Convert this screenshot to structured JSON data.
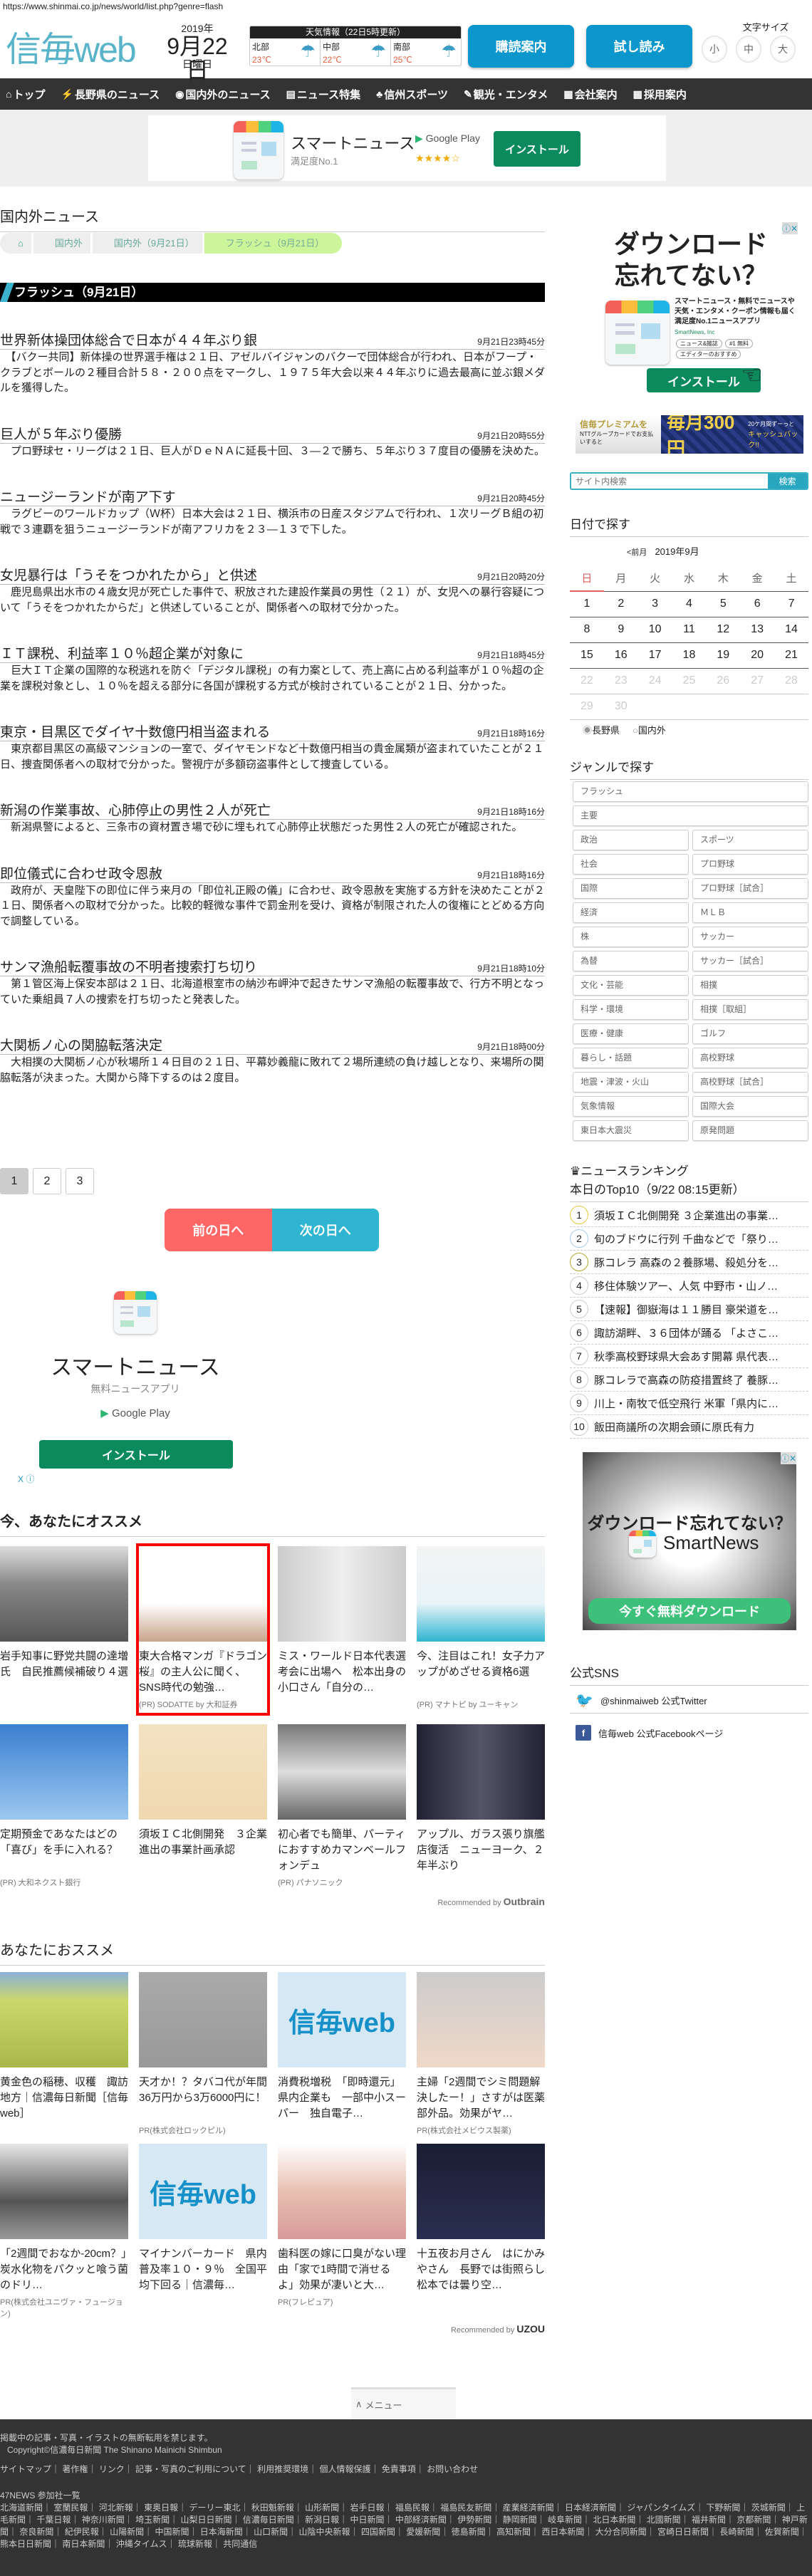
{
  "url": "https://www.shinmai.co.jp/news/world/list.php?genre=flash",
  "header": {
    "logo": "信毎web",
    "year": "2019年",
    "date": "9月22日",
    "weekday": "日曜日",
    "weather": {
      "title": "天気情報（22日5時更新）",
      "regions": [
        {
          "name": "北部",
          "temp": "23℃"
        },
        {
          "name": "中部",
          "temp": "22℃"
        },
        {
          "name": "南部",
          "temp": "25℃"
        }
      ]
    },
    "subscribe": "購読案内",
    "trial": "試し読み",
    "font_size_label": "文字サイズ",
    "font_sizes": [
      "小",
      "中",
      "大"
    ]
  },
  "nav": [
    {
      "icon": "⌂",
      "label": "トップ"
    },
    {
      "icon": "⚡",
      "label": "長野県のニュース"
    },
    {
      "icon": "◉",
      "label": "国内外のニュース"
    },
    {
      "icon": "▤",
      "label": "ニュース特集"
    },
    {
      "icon": "♣",
      "label": "信州スポーツ"
    },
    {
      "icon": "✎",
      "label": "観光・エンタメ"
    },
    {
      "icon": "▦",
      "label": "会社案内"
    },
    {
      "icon": "▦",
      "label": "採用案内"
    }
  ],
  "top_ad": {
    "app": "スマートニュース",
    "sub": "満足度No.1",
    "store": "Google Play",
    "stars": "★★★★☆",
    "install": "インストール"
  },
  "page_title": "国内外ニュース",
  "breadcrumb": [
    "国内外",
    "国内外（9月21日）",
    "フラッシュ（9月21日）"
  ],
  "section_title": "フラッシュ（9月21日）",
  "articles": [
    {
      "title": "世界新体操団体総合で日本が４４年ぶり銀",
      "time": "9月21日23時45分",
      "body": "　【バクー共同】新体操の世界選手権は２１日、アゼルバイジャンのバクーで団体総合が行われ、日本がフープ・クラブとボールの２種目合計５８・２００点をマークし、１９７５年大会以来４４年ぶりに過去最高に並ぶ銀メダルを獲得した。"
    },
    {
      "title": "巨人が５年ぶり優勝",
      "time": "9月21日20時55分",
      "body": "　プロ野球セ・リーグは２１日、巨人がＤｅＮＡに延長十回、３―２で勝ち、５年ぶり３７度目の優勝を決めた。"
    },
    {
      "title": "ニュージーランドが南ア下す",
      "time": "9月21日20時45分",
      "body": "　ラグビーのワールドカップ（Ｗ杯）日本大会は２１日、横浜市の日産スタジアムで行われ、１次リーグＢ組の初戦で３連覇を狙うニュージーランドが南アフリカを２３―１３で下した。"
    },
    {
      "title": "女児暴行は「うそをつかれたから」と供述",
      "time": "9月21日20時20分",
      "body": "　鹿児島県出水市の４歳女児が死亡した事件で、釈放された建設作業員の男性（２１）が、女児への暴行容疑について「うそをつかれたからだ」と供述していることが、関係者への取材で分かった。"
    },
    {
      "title": "ＩＴ課税、利益率１０％超企業が対象に",
      "time": "9月21日18時45分",
      "body": "　巨大ＩＴ企業の国際的な税逃れを防ぐ「デジタル課税」の有力案として、売上高に占める利益率が１０％超の企業を課税対象とし、１０％を超える部分に各国が課税する方式が検討されていることが２１日、分かった。"
    },
    {
      "title": "東京・目黒区でダイヤ十数億円相当盗まれる",
      "time": "9月21日18時16分",
      "body": "　東京都目黒区の高級マンションの一室で、ダイヤモンドなど十数億円相当の貴金属類が盗まれていたことが２１日、捜査関係者への取材で分かった。警視庁が多額窃盗事件として捜査している。"
    },
    {
      "title": "新潟の作業事故、心肺停止の男性２人が死亡",
      "time": "9月21日18時16分",
      "body": "　新潟県警によると、三条市の資材置き場で砂に埋もれて心肺停止状態だった男性２人の死亡が確認された。"
    },
    {
      "title": "即位儀式に合わせ政令恩赦",
      "time": "9月21日18時16分",
      "body": "　政府が、天皇陛下の即位に伴う来月の「即位礼正殿の儀」に合わせ、政令恩赦を実施する方針を決めたことが２１日、関係者への取材で分かった。比較的軽微な事件で罰金刑を受け、資格が制限された人の復権にとどめる方向で調整している。"
    },
    {
      "title": "サンマ漁船転覆事故の不明者捜索打ち切り",
      "time": "9月21日18時10分",
      "body": "　第１管区海上保安本部は２１日、北海道根室市の納沙布岬沖で起きたサンマ漁船の転覆事故で、行方不明となっていた乗組員７人の捜索を打ち切ったと発表した。"
    },
    {
      "title": "大関栃ノ心の関脇転落決定",
      "time": "9月21日18時00分",
      "body": "　大相撲の大関栃ノ心が秋場所１４日目の２１日、平幕妙義龍に敗れて２場所連続の負け越しとなり、来場所の関脇転落が決まった。大関から降下するのは２度目。"
    }
  ],
  "pages": [
    "1",
    "2",
    "3"
  ],
  "prev_day": "前の日へ",
  "next_day": "次の日へ",
  "mid_ad": {
    "app": "スマートニュース",
    "sub": "無料ニュースアプリ",
    "store": "Google Play",
    "install": "インストール",
    "close": "X ⓘ"
  },
  "reco1": {
    "title": "今、あなたにオススメ",
    "items": [
      {
        "title": "岩手知事に野党共闘の達増氏　自民推薦候補破り４選",
        "pr": ""
      },
      {
        "title": "東大合格マンガ『ドラゴン桜』の主人公に聞く、SNS時代の勉強…",
        "pr": "(PR) SODATTE by 大和証券"
      },
      {
        "title": "ミス・ワールド日本代表選考会に出場へ　松本出身の小口さん「自分の…",
        "pr": ""
      },
      {
        "title": "今、注目はこれ！女子力アップがめざせる資格6選",
        "pr": "(PR) マナトピ by ユーキャン"
      },
      {
        "title": "定期預金であなたはどの「喜び」を手に入れる？",
        "pr": "(PR) 大和ネクスト銀行"
      },
      {
        "title": "須坂ＩＣ北側開発　３企業進出の事業計画承認",
        "pr": ""
      },
      {
        "title": "初心者でも簡単、パーティにおすすめカマンベールフォンデュ",
        "pr": "(PR) パナソニック"
      },
      {
        "title": "アップル、ガラス張り旗艦店復活　ニューヨーク、２年半ぶり",
        "pr": ""
      }
    ],
    "credit": "Recommended by",
    "brand": "Outbrain"
  },
  "reco2": {
    "title": "あなたにおススメ",
    "items": [
      {
        "title": "黄金色の稲穂、収穫　諏訪地方｜信濃毎日新聞［信毎web］",
        "pr": ""
      },
      {
        "title": "天才か！？タバコ代が年間36万円から3万6000円に！",
        "pr": "PR(株式会社ロックピル)"
      },
      {
        "title": "消費税増税　「即時還元」県内企業も　一部中小スーパー　独自電子…",
        "pr": ""
      },
      {
        "title": "主婦「2週間でシミ問題解決したー！」さすがは医薬部外品。効果がヤ…",
        "pr": "PR(株式会社メビウス製薬)"
      },
      {
        "title": "「2週間でおなか-20cm？」炭水化物をパクッと喰う菌のドリ…",
        "pr": "PR(株式会社ユニヴァ・フュージョン)"
      },
      {
        "title": "マイナンバーカード　県内普及率１０・９％　全国平均下回る｜信濃毎…",
        "pr": ""
      },
      {
        "title": "歯科医の嫁に口臭がない理由「家で1時間で消せるよ」効果が凄いと大…",
        "pr": "PR(フレピュア)"
      },
      {
        "title": "十五夜お月さん　はにかみやさん　長野では街照らし　松本では曇り空…",
        "pr": ""
      }
    ],
    "credit": "Recommended by",
    "brand": "UZOU"
  },
  "thumb_logo": "信毎web",
  "side_ad1": {
    "headline1": "ダウンロード",
    "headline2": "忘れてない？",
    "desc": "スマートニュース・無料でニュースや天気・エンタメ・クーポン情報も届く満足度No.1ニュースアプリ",
    "company": "SmartNews, Inc",
    "tags": [
      "ニュース&雑誌",
      "#1 無料",
      "エディターのおすすめ"
    ],
    "install": "インストール"
  },
  "premium": {
    "line1": "信毎プレミアムを",
    "line2": "NTTグループカードでお支払いすると",
    "big": "毎月300円",
    "small": "20ケ月間ずーっと",
    "cb": "キャッシュバック!!"
  },
  "search": {
    "placeholder": "サイト内検索",
    "button": "検索"
  },
  "calendar": {
    "title": "日付で探す",
    "prev": "<前月",
    "month": "2019年9月",
    "weekdays": [
      "日",
      "月",
      "火",
      "水",
      "木",
      "金",
      "土"
    ],
    "last_active_day": 21,
    "radios": [
      "長野県",
      "国内外"
    ],
    "selected_radio": "長野県"
  },
  "genre": {
    "title": "ジャンルで探す",
    "wide": [
      "フラッシュ",
      "主要"
    ],
    "pairs": [
      "政治",
      "スポーツ",
      "社会",
      "プロ野球",
      "国際",
      "プロ野球［試合］",
      "経済",
      "ＭＬＢ",
      "株",
      "サッカー",
      "為替",
      "サッカー［試合］",
      "文化・芸能",
      "相撲",
      "科学・環境",
      "相撲［取組］",
      "医療・健康",
      "ゴルフ",
      "暮らし・話題",
      "高校野球",
      "地震・津波・火山",
      "高校野球［試合］",
      "気象情報",
      "国際大会",
      "東日本大震災",
      "原発問題"
    ]
  },
  "ranking": {
    "title": "ニュースランキング",
    "subtitle": "本日のTop10（9/22 08:15更新）",
    "items": [
      "須坂ＩＣ北側開発 ３企業進出の事業…",
      "旬のブドウに行列 千曲などで「祭り…",
      "豚コレラ 高森の２養豚場、殺処分を…",
      "移住体験ツアー、人気 中野市・山ノ…",
      "【速報】御嶽海は１１勝目 豪栄道を…",
      "諏訪湖畔、３６団体が踊る 「よさこ…",
      "秋季高校野球県大会あす開幕 県代表…",
      "豚コレラで高森の防疫措置終了 養豚…",
      "川上・南牧で低空飛行 米軍「県内に…",
      "飯田商議所の次期会頭に原氏有力"
    ],
    "colors": [
      "#e8c840",
      "#a8cbe8",
      "#b8a830"
    ]
  },
  "side_ad2": {
    "headline": "ダウンロード忘れてない？",
    "brand": "SmartNews",
    "cta": "今すぐ無料ダウンロード"
  },
  "sns": {
    "title": "公式SNS",
    "twitter": "@shinmaiweb 公式Twitter",
    "facebook": "信毎web 公式Facebookページ"
  },
  "menu_tab": "メニュー",
  "footer": {
    "notice": "掲載中の記事・写真・イラストの無断転用を禁じます。",
    "copyright": "Copyright©信濃毎日新聞 The Shinano Mainichi Shimbun",
    "links": [
      "サイトマップ",
      "著作権",
      "リンク",
      "記事・写真のご利用について",
      "利用推奨環境",
      "個人情報保護",
      "免責事項",
      "お問い合わせ"
    ],
    "news47": "47NEWS 参加社一覧",
    "papers": [
      "北海道新聞",
      "室蘭民報",
      "河北新報",
      "東奥日報",
      "デーリー東北",
      "秋田魁新報",
      "山形新聞",
      "岩手日報",
      "福島民報",
      "福島民友新聞",
      "産業経済新聞",
      "日本経済新聞",
      "ジャパンタイムズ",
      "下野新聞",
      "茨城新聞",
      "上毛新聞",
      "千葉日報",
      "神奈川新聞",
      "埼玉新聞",
      "山梨日日新聞",
      "信濃毎日新聞",
      "新潟日報",
      "中日新聞",
      "中部経済新聞",
      "伊勢新聞",
      "静岡新聞",
      "岐阜新聞",
      "北日本新聞",
      "北國新聞",
      "福井新聞",
      "京都新聞",
      "神戸新聞",
      "奈良新聞",
      "紀伊民報",
      "山陽新聞",
      "中国新聞",
      "日本海新聞",
      "山口新聞",
      "山陰中央新報",
      "四国新聞",
      "愛媛新聞",
      "徳島新聞",
      "高知新聞",
      "西日本新聞",
      "大分合同新聞",
      "宮崎日日新聞",
      "長崎新聞",
      "佐賀新聞",
      "熊本日日新聞",
      "南日本新聞",
      "沖縄タイムス",
      "琉球新報",
      "共同通信"
    ]
  },
  "colors": {
    "brand": "#5ab4c9",
    "button": "#0b96cc",
    "prev": "#ff6666",
    "next": "#2fb5d2",
    "install": "#0a8a5d",
    "highlight": "#ff0000"
  }
}
